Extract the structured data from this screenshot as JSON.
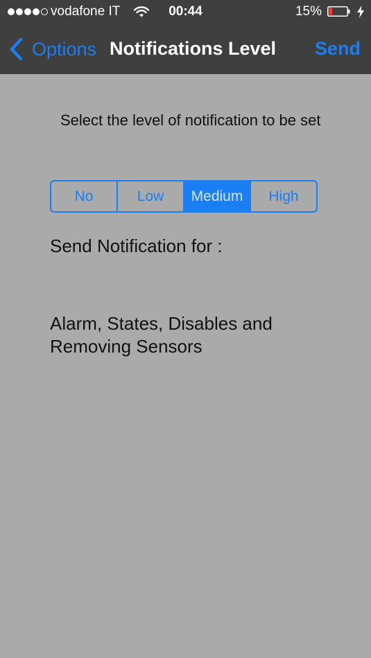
{
  "status_bar": {
    "carrier": "vodafone IT",
    "time": "00:44",
    "battery_percent": "15%",
    "signal_bars_filled": 4,
    "signal_bars_total": 5
  },
  "nav_bar": {
    "back_label": "Options",
    "title": "Notifications Level",
    "action_label": "Send"
  },
  "content": {
    "instruction": "Select the level of notification to be set",
    "levels": [
      "No",
      "Low",
      "Medium",
      "High"
    ],
    "selected_level": "Medium",
    "send_for_label": "Send Notification for :",
    "description": "Alarm, States, Disables and Removing Sensors"
  },
  "colors": {
    "accent": "#1a7ff5",
    "nav_background": "#3f3f3f",
    "content_background": "#aaaaaa",
    "battery_low": "#ff3b30"
  },
  "icons": {
    "signal": "signal-dots-icon",
    "wifi": "wifi-icon",
    "battery": "battery-icon",
    "charging": "charging-bolt-icon",
    "back": "chevron-left-icon"
  }
}
